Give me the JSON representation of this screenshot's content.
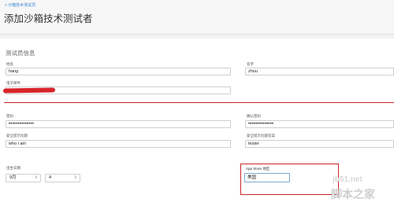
{
  "header": {
    "back_label": "< 沙箱技术测试员",
    "title": "添加沙箱技术测试者"
  },
  "section_title": "测试员信息",
  "form": {
    "last_name": {
      "label": "姓名",
      "value": "hang"
    },
    "first_name": {
      "label": "名字",
      "value": "zhou"
    },
    "email": {
      "label": "电子邮件",
      "value": ""
    },
    "password": {
      "label": "密码",
      "value": "••••••••••••••"
    },
    "confirm_password": {
      "label": "确认密码",
      "value": "••••••••••••••"
    },
    "security_question": {
      "label": "安全提示问题",
      "value": "who i am"
    },
    "security_answer": {
      "label": "安全提示问题答案",
      "value": "tester"
    },
    "birth_date": {
      "label": "出生日期",
      "month": "9月",
      "day": "4"
    },
    "app_store_region": {
      "label": "App Store 地区",
      "value": "美国"
    }
  },
  "watermark": {
    "site": "jb51.net",
    "name": "脚本之家"
  },
  "colors": {
    "accent": "#3b86d6",
    "highlight_red": "#c9252b"
  },
  "icons": {
    "back": "chevron-left-icon",
    "select": "chevron-updown-icon"
  }
}
